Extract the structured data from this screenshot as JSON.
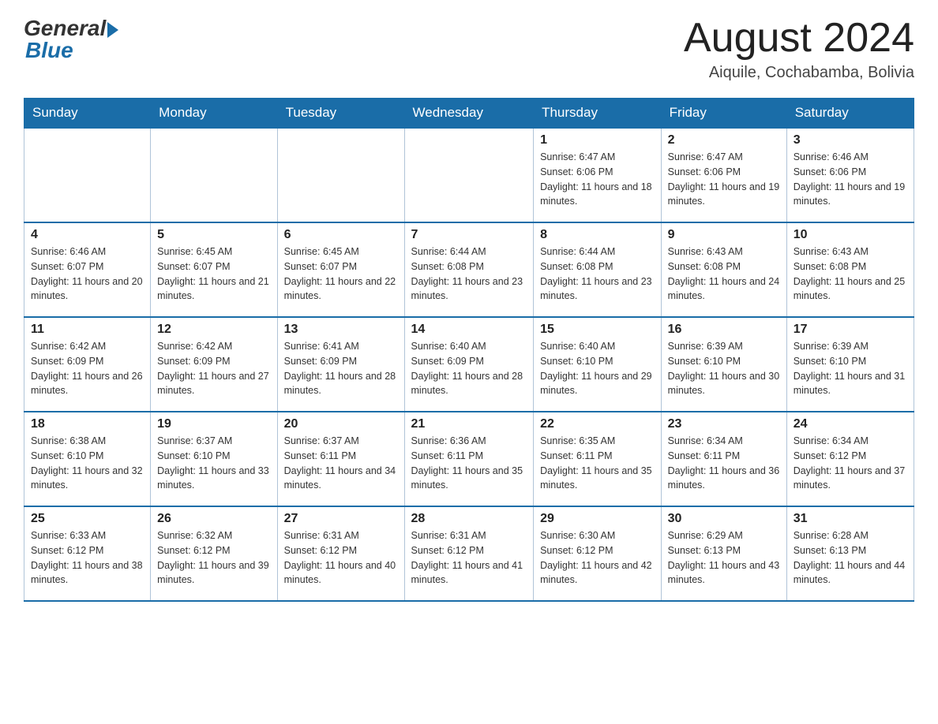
{
  "header": {
    "logo_general": "General",
    "logo_blue": "Blue",
    "month_title": "August 2024",
    "location": "Aiquile, Cochabamba, Bolivia"
  },
  "days_of_week": [
    "Sunday",
    "Monday",
    "Tuesday",
    "Wednesday",
    "Thursday",
    "Friday",
    "Saturday"
  ],
  "weeks": [
    [
      {
        "day": "",
        "info": ""
      },
      {
        "day": "",
        "info": ""
      },
      {
        "day": "",
        "info": ""
      },
      {
        "day": "",
        "info": ""
      },
      {
        "day": "1",
        "info": "Sunrise: 6:47 AM\nSunset: 6:06 PM\nDaylight: 11 hours and 18 minutes."
      },
      {
        "day": "2",
        "info": "Sunrise: 6:47 AM\nSunset: 6:06 PM\nDaylight: 11 hours and 19 minutes."
      },
      {
        "day": "3",
        "info": "Sunrise: 6:46 AM\nSunset: 6:06 PM\nDaylight: 11 hours and 19 minutes."
      }
    ],
    [
      {
        "day": "4",
        "info": "Sunrise: 6:46 AM\nSunset: 6:07 PM\nDaylight: 11 hours and 20 minutes."
      },
      {
        "day": "5",
        "info": "Sunrise: 6:45 AM\nSunset: 6:07 PM\nDaylight: 11 hours and 21 minutes."
      },
      {
        "day": "6",
        "info": "Sunrise: 6:45 AM\nSunset: 6:07 PM\nDaylight: 11 hours and 22 minutes."
      },
      {
        "day": "7",
        "info": "Sunrise: 6:44 AM\nSunset: 6:08 PM\nDaylight: 11 hours and 23 minutes."
      },
      {
        "day": "8",
        "info": "Sunrise: 6:44 AM\nSunset: 6:08 PM\nDaylight: 11 hours and 23 minutes."
      },
      {
        "day": "9",
        "info": "Sunrise: 6:43 AM\nSunset: 6:08 PM\nDaylight: 11 hours and 24 minutes."
      },
      {
        "day": "10",
        "info": "Sunrise: 6:43 AM\nSunset: 6:08 PM\nDaylight: 11 hours and 25 minutes."
      }
    ],
    [
      {
        "day": "11",
        "info": "Sunrise: 6:42 AM\nSunset: 6:09 PM\nDaylight: 11 hours and 26 minutes."
      },
      {
        "day": "12",
        "info": "Sunrise: 6:42 AM\nSunset: 6:09 PM\nDaylight: 11 hours and 27 minutes."
      },
      {
        "day": "13",
        "info": "Sunrise: 6:41 AM\nSunset: 6:09 PM\nDaylight: 11 hours and 28 minutes."
      },
      {
        "day": "14",
        "info": "Sunrise: 6:40 AM\nSunset: 6:09 PM\nDaylight: 11 hours and 28 minutes."
      },
      {
        "day": "15",
        "info": "Sunrise: 6:40 AM\nSunset: 6:10 PM\nDaylight: 11 hours and 29 minutes."
      },
      {
        "day": "16",
        "info": "Sunrise: 6:39 AM\nSunset: 6:10 PM\nDaylight: 11 hours and 30 minutes."
      },
      {
        "day": "17",
        "info": "Sunrise: 6:39 AM\nSunset: 6:10 PM\nDaylight: 11 hours and 31 minutes."
      }
    ],
    [
      {
        "day": "18",
        "info": "Sunrise: 6:38 AM\nSunset: 6:10 PM\nDaylight: 11 hours and 32 minutes."
      },
      {
        "day": "19",
        "info": "Sunrise: 6:37 AM\nSunset: 6:10 PM\nDaylight: 11 hours and 33 minutes."
      },
      {
        "day": "20",
        "info": "Sunrise: 6:37 AM\nSunset: 6:11 PM\nDaylight: 11 hours and 34 minutes."
      },
      {
        "day": "21",
        "info": "Sunrise: 6:36 AM\nSunset: 6:11 PM\nDaylight: 11 hours and 35 minutes."
      },
      {
        "day": "22",
        "info": "Sunrise: 6:35 AM\nSunset: 6:11 PM\nDaylight: 11 hours and 35 minutes."
      },
      {
        "day": "23",
        "info": "Sunrise: 6:34 AM\nSunset: 6:11 PM\nDaylight: 11 hours and 36 minutes."
      },
      {
        "day": "24",
        "info": "Sunrise: 6:34 AM\nSunset: 6:12 PM\nDaylight: 11 hours and 37 minutes."
      }
    ],
    [
      {
        "day": "25",
        "info": "Sunrise: 6:33 AM\nSunset: 6:12 PM\nDaylight: 11 hours and 38 minutes."
      },
      {
        "day": "26",
        "info": "Sunrise: 6:32 AM\nSunset: 6:12 PM\nDaylight: 11 hours and 39 minutes."
      },
      {
        "day": "27",
        "info": "Sunrise: 6:31 AM\nSunset: 6:12 PM\nDaylight: 11 hours and 40 minutes."
      },
      {
        "day": "28",
        "info": "Sunrise: 6:31 AM\nSunset: 6:12 PM\nDaylight: 11 hours and 41 minutes."
      },
      {
        "day": "29",
        "info": "Sunrise: 6:30 AM\nSunset: 6:12 PM\nDaylight: 11 hours and 42 minutes."
      },
      {
        "day": "30",
        "info": "Sunrise: 6:29 AM\nSunset: 6:13 PM\nDaylight: 11 hours and 43 minutes."
      },
      {
        "day": "31",
        "info": "Sunrise: 6:28 AM\nSunset: 6:13 PM\nDaylight: 11 hours and 44 minutes."
      }
    ]
  ]
}
